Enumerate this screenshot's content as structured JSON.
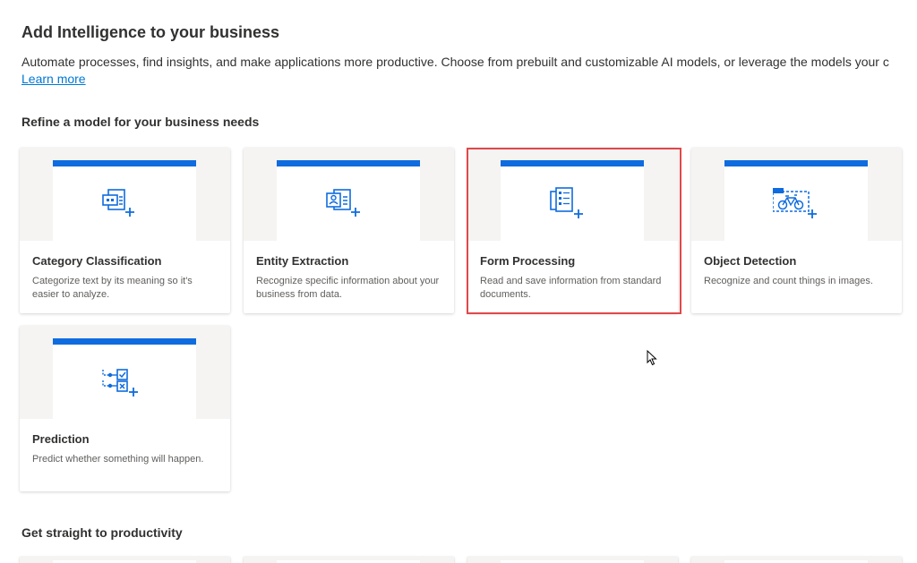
{
  "header": {
    "title": "Add Intelligence to your business",
    "description": "Automate processes, find insights, and make applications more productive. Choose from prebuilt and customizable AI models, or leverage the models your c",
    "learn_more": "Learn more"
  },
  "sections": {
    "refine_title": "Refine a model for your business needs",
    "productivity_title": "Get straight to productivity"
  },
  "cards": [
    {
      "name": "Category Classification",
      "description": "Categorize text by its meaning so it's easier to analyze.",
      "icon": "category-classification-icon"
    },
    {
      "name": "Entity Extraction",
      "description": "Recognize specific information about your business from data.",
      "icon": "entity-extraction-icon"
    },
    {
      "name": "Form Processing",
      "description": "Read and save information from standard documents.",
      "icon": "form-processing-icon"
    },
    {
      "name": "Object Detection",
      "description": "Recognize and count things in images.",
      "icon": "object-detection-icon"
    },
    {
      "name": "Prediction",
      "description": "Predict whether something will happen.",
      "icon": "prediction-icon"
    }
  ],
  "colors": {
    "accent": "#0f6cde",
    "link": "#0078d4",
    "highlight": "#e0484a"
  }
}
